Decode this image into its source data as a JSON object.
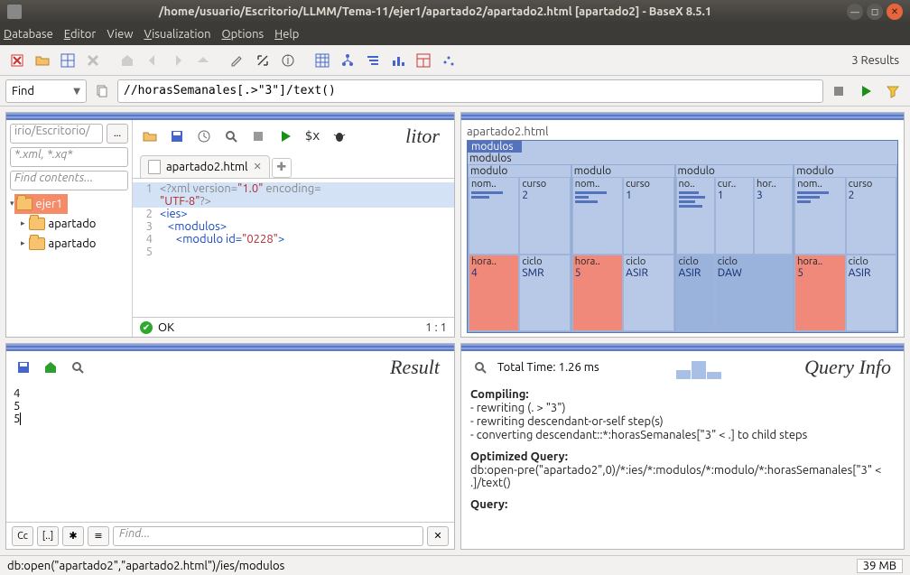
{
  "window": {
    "title": "/home/usuario/Escritorio/LLMM/Tema-11/ejer1/apartado2/apartado2.html [apartado2] - BaseX 8.5.1"
  },
  "menu": {
    "database": "Database",
    "editor": "Editor",
    "view": "View",
    "visualization": "Visualization",
    "options": "Options",
    "help": "Help"
  },
  "toolbar": {
    "results": "3 Results"
  },
  "query": {
    "mode": "Find",
    "input": "//horasSemanales[.>\"3\"]/text()"
  },
  "project": {
    "path": "irio/Escritorio/",
    "filter": "*.xml, *.xq*",
    "find_contents": "Find contents...",
    "browse": "...",
    "tree": {
      "root": "ejer1",
      "items": [
        "apartado",
        "apartado"
      ]
    }
  },
  "editor": {
    "title": "Editor",
    "tab": "apartado2.html",
    "status": "OK",
    "cursor": "1 : 1",
    "lines": {
      "l1a": "<?xml version=",
      "l1b": "\"1.0\"",
      "l1c": " encoding=",
      "l1d": "\"UTF-8\"",
      "l1e": "?>",
      "l2": "<ies>",
      "l3": "   <modulos>",
      "l4a": "      <modulo id=",
      "l4b": "\"0228\"",
      "l4c": ">"
    }
  },
  "map": {
    "file": "apartado2.html",
    "root": "modulos",
    "modulos_label": "modulos",
    "modulo_label": "modulo",
    "labels": {
      "nom": "nom..",
      "curso": "curso",
      "no": "no..",
      "cur": "cur..",
      "hor": "hor..",
      "hora": "hora..",
      "ciclo": "ciclo"
    },
    "data": [
      {
        "curso": "2",
        "horas": "4",
        "ciclo": "SMR"
      },
      {
        "curso": "1",
        "horas": "5",
        "ciclo": "ASIR"
      },
      {
        "curso": "1",
        "hor": "3",
        "ciclo1": "ASIR",
        "ciclo2": "DAW"
      },
      {
        "curso": "2",
        "horas": "5",
        "ciclo": "ASIR"
      }
    ]
  },
  "result": {
    "title": "Result",
    "lines": [
      "4",
      "5",
      "5"
    ],
    "find": "Find...",
    "btns": {
      "cc": "Cc",
      "brk": "[..]",
      "star": "✱",
      "bars": "≡"
    }
  },
  "queryinfo": {
    "title": "Query Info",
    "total_time_label": "Total Time: ",
    "total_time": "1.26 ms",
    "compiling_label": "Compiling:",
    "compiling": [
      "- rewriting (. > \"3\")",
      "- rewriting descendant-or-self step(s)",
      "- converting descendant::*:horasSemanales[\"3\" < .] to child steps"
    ],
    "optimized_label": "Optimized Query:",
    "optimized": "db:open-pre(\"apartado2\",0)/*:ies/*:modulos/*:modulo/*:horasSemanales[\"3\" < .]/text()",
    "query_label": "Query:"
  },
  "statusbar": {
    "path": "db:open(\"apartado2\",\"apartado2.html\")/ies/modulos",
    "mem": "39 MB"
  }
}
